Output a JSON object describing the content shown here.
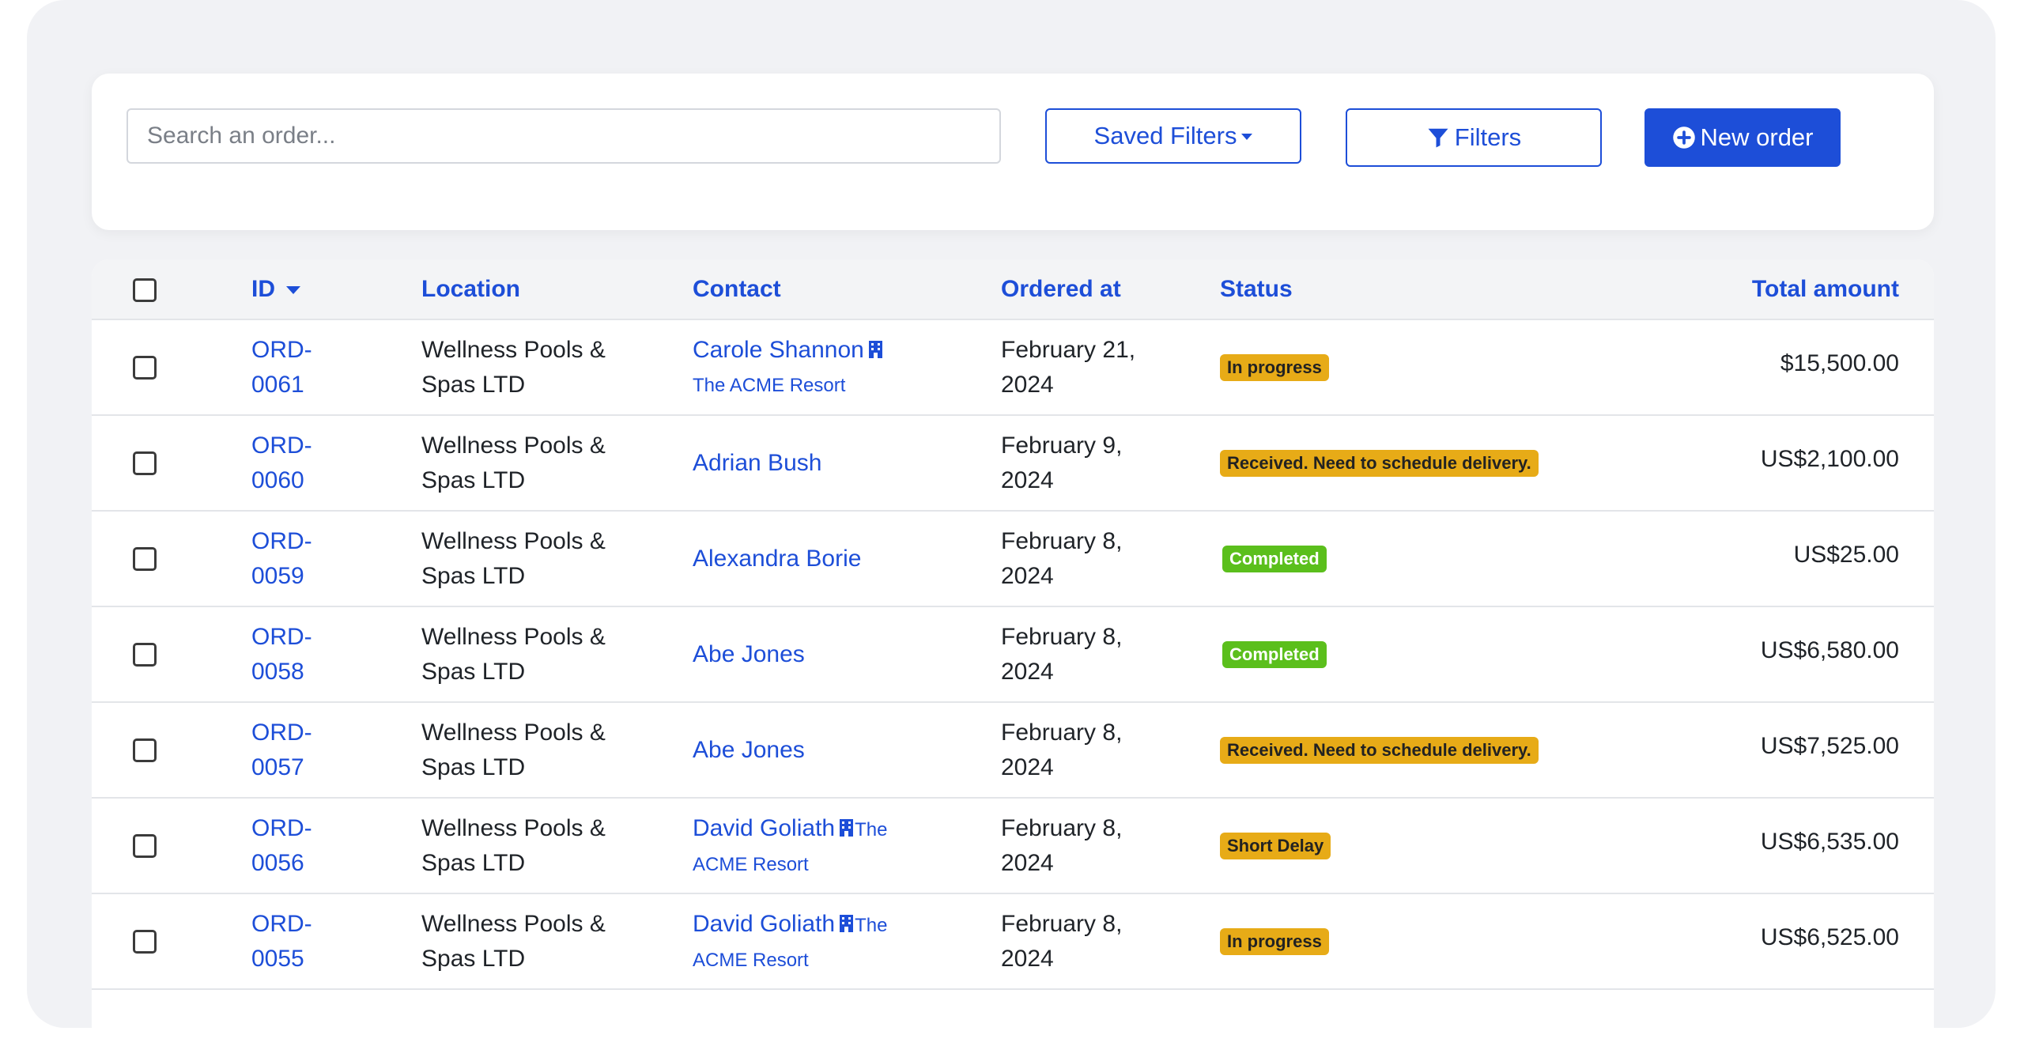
{
  "toolbar": {
    "search_placeholder": "Search an order...",
    "saved_filters_label": "Saved Filters",
    "filters_label": "Filters",
    "new_order_label": "New order"
  },
  "table": {
    "columns": {
      "id": "ID",
      "location": "Location",
      "contact": "Contact",
      "ordered_at": "Ordered at",
      "status": "Status",
      "total": "Total amount"
    },
    "sort": {
      "column": "ID",
      "direction": "descending"
    },
    "rows": [
      {
        "id_a": "ORD-",
        "id_b": "0061",
        "loc_a": "Wellness Pools &",
        "loc_b": "Spas LTD",
        "contact": "Carole Shannon",
        "company_a": "",
        "company_b": "The ACME Resort",
        "date_a": "February 21,",
        "date_b": "2024",
        "status": "In progress",
        "status_kind": "warn",
        "total": "$15,500.00"
      },
      {
        "id_a": "ORD-",
        "id_b": "0060",
        "loc_a": "Wellness Pools &",
        "loc_b": "Spas LTD",
        "contact": "Adrian Bush",
        "company_a": "",
        "company_b": "",
        "date_a": "February 9,",
        "date_b": "2024",
        "status": "Received. Need to schedule delivery.",
        "status_kind": "warn",
        "total": "US$2,100.00"
      },
      {
        "id_a": "ORD-",
        "id_b": "0059",
        "loc_a": "Wellness Pools &",
        "loc_b": "Spas LTD",
        "contact": "Alexandra Borie",
        "company_a": "",
        "company_b": "",
        "date_a": "February 8,",
        "date_b": "2024",
        "status": "Completed",
        "status_kind": "ok",
        "total": "US$25.00"
      },
      {
        "id_a": "ORD-",
        "id_b": "0058",
        "loc_a": "Wellness Pools &",
        "loc_b": "Spas LTD",
        "contact": "Abe Jones",
        "company_a": "",
        "company_b": "",
        "date_a": "February 8,",
        "date_b": "2024",
        "status": "Completed",
        "status_kind": "ok",
        "total": "US$6,580.00"
      },
      {
        "id_a": "ORD-",
        "id_b": "0057",
        "loc_a": "Wellness Pools &",
        "loc_b": "Spas LTD",
        "contact": "Abe Jones",
        "company_a": "",
        "company_b": "",
        "date_a": "February 8,",
        "date_b": "2024",
        "status": "Received. Need to schedule delivery.",
        "status_kind": "warn",
        "total": "US$7,525.00"
      },
      {
        "id_a": "ORD-",
        "id_b": "0056",
        "loc_a": "Wellness Pools &",
        "loc_b": "Spas LTD",
        "contact": "David Goliath",
        "company_a": "The",
        "company_b": "ACME Resort",
        "date_a": "February 8,",
        "date_b": "2024",
        "status": "Short Delay",
        "status_kind": "warn",
        "total": "US$6,535.00"
      },
      {
        "id_a": "ORD-",
        "id_b": "0055",
        "loc_a": "Wellness Pools &",
        "loc_b": "Spas LTD",
        "contact": "David Goliath",
        "company_a": "The",
        "company_b": "ACME Resort",
        "date_a": "February 8,",
        "date_b": "2024",
        "status": "In progress",
        "status_kind": "warn",
        "total": "US$6,525.00"
      }
    ]
  },
  "colors": {
    "accent": "#1d4ed8",
    "warning_badge": "#e7ab17",
    "success_badge": "#5bbf1c",
    "page_background": "#f1f2f5"
  },
  "icons": {
    "saved_filters": "caret-down-icon",
    "filters": "funnel-icon",
    "new_order": "plus-circle-icon",
    "sort": "sort-desc-icon",
    "company": "building-icon"
  }
}
